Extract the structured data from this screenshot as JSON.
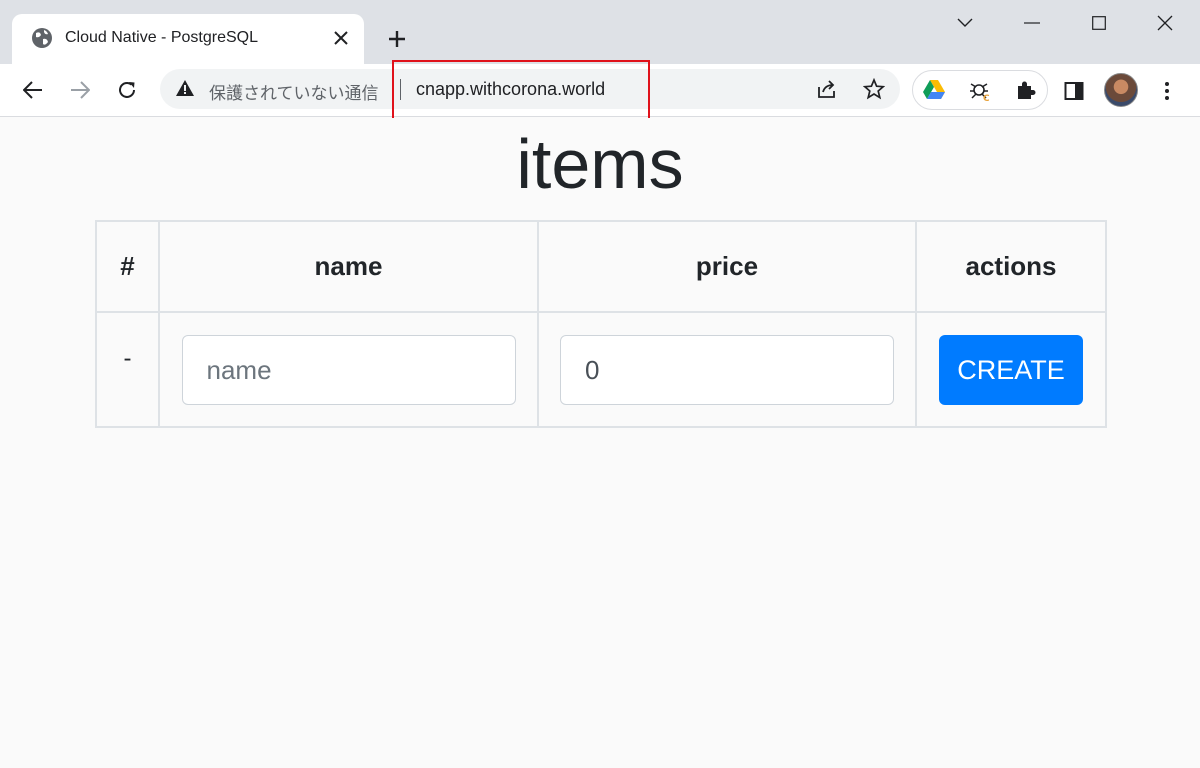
{
  "tab": {
    "title": "Cloud Native - PostgreSQL"
  },
  "address_bar": {
    "security_text": "保護されていない通信",
    "url": "cnapp.withcorona.world"
  },
  "page": {
    "title": "items",
    "table": {
      "headers": [
        "#",
        "name",
        "price",
        "actions"
      ],
      "new_row": {
        "index": "-",
        "name_placeholder": "name",
        "price_value": "0",
        "create_label": "CREATE"
      }
    }
  },
  "colors": {
    "primary_button": "#007bff",
    "highlight_box": "#e0121b"
  },
  "icons": [
    "globe-icon",
    "close-icon",
    "plus-icon",
    "chevron-down-icon",
    "minimize-icon",
    "maximize-icon",
    "window-close-icon",
    "back-arrow-icon",
    "forward-arrow-icon",
    "reload-icon",
    "warning-icon",
    "share-icon",
    "star-icon",
    "google-drive-icon",
    "extension-bug-icon",
    "puzzle-icon",
    "side-panel-icon",
    "avatar",
    "more-vert-icon"
  ]
}
